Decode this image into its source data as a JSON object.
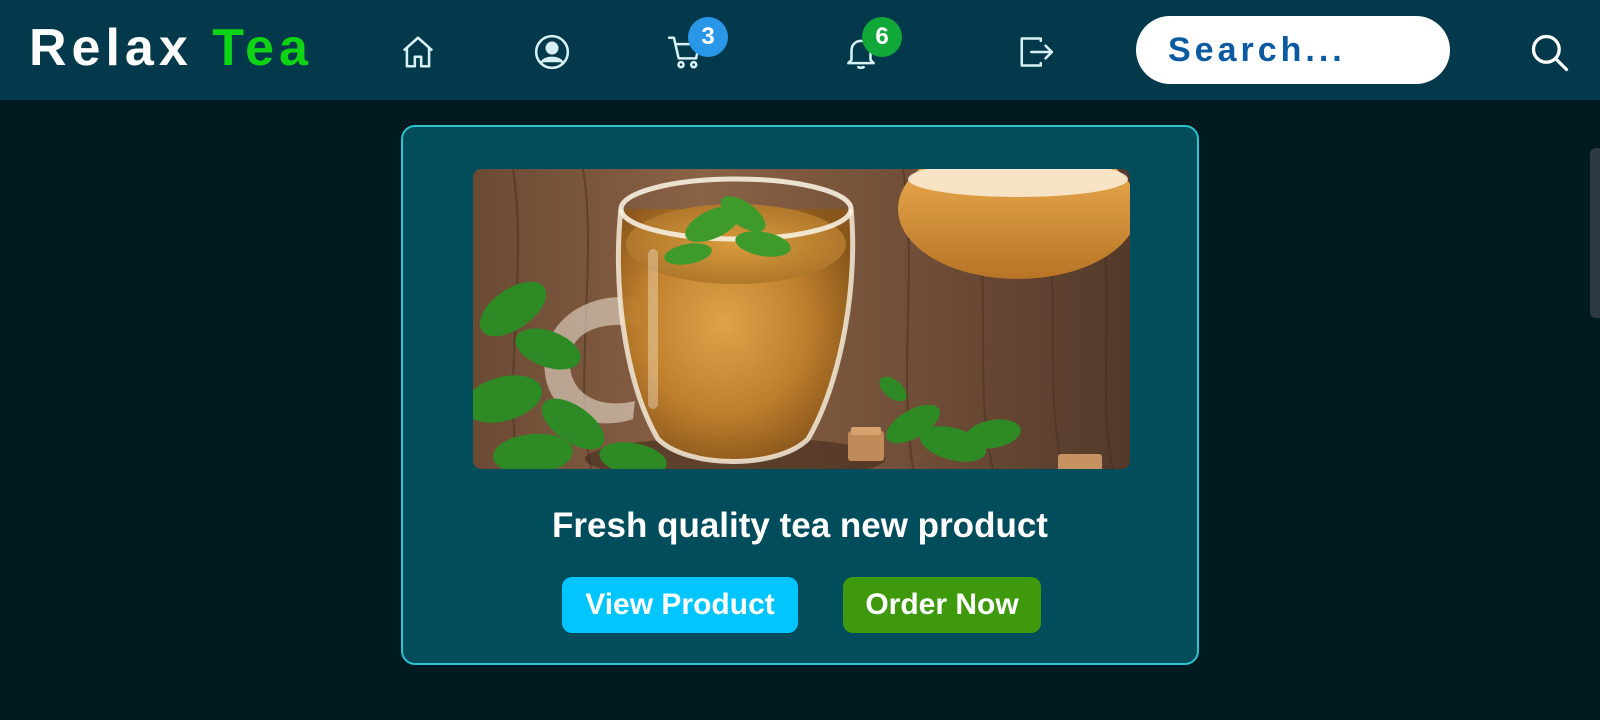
{
  "brand": {
    "part1": "Relax",
    "part2": "Tea"
  },
  "nav": {
    "cart_count": "3",
    "notification_count": "6"
  },
  "search": {
    "placeholder": "Search..."
  },
  "product": {
    "title": "Fresh quality tea new product",
    "view_label": "View Product",
    "order_label": "Order Now"
  },
  "colors": {
    "navbar": "#03394a",
    "background": "#001a22",
    "card": "#024d5c",
    "card_border": "#2ec3cf",
    "brand_accent": "#0fd414",
    "view_button": "#00c5ff",
    "order_button": "#3e9a0c"
  },
  "icons": [
    "home-icon",
    "user-icon",
    "cart-icon",
    "bell-icon",
    "logout-icon",
    "search-icon"
  ]
}
